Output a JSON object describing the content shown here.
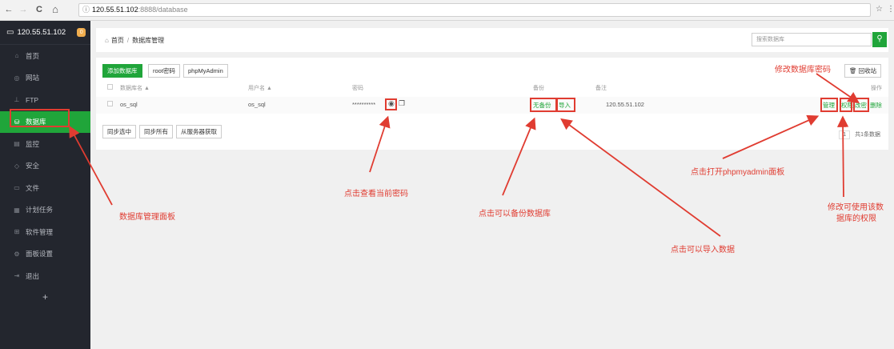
{
  "browser": {
    "back": "←",
    "forward": "→",
    "reload": "C",
    "home": "⌂",
    "info": "ⓘ",
    "host": "120.55.51.102",
    "path": ":8888/database",
    "star": "☆",
    "menu": "⋮"
  },
  "sidebar": {
    "server": "120.55.51.102",
    "badge": "0",
    "items": [
      {
        "label": "首页",
        "icon": "home-icon"
      },
      {
        "label": "网站",
        "icon": "globe-icon"
      },
      {
        "label": "FTP",
        "icon": "ftp-icon"
      },
      {
        "label": "数据库",
        "icon": "database-icon"
      },
      {
        "label": "监控",
        "icon": "monitor-icon"
      },
      {
        "label": "安全",
        "icon": "shield-icon"
      },
      {
        "label": "文件",
        "icon": "folder-icon"
      },
      {
        "label": "计划任务",
        "icon": "calendar-icon"
      },
      {
        "label": "软件管理",
        "icon": "grid-icon"
      },
      {
        "label": "面板设置",
        "icon": "gear-icon"
      },
      {
        "label": "退出",
        "icon": "logout-icon"
      }
    ],
    "add": "+"
  },
  "topbar": {
    "home": "首页",
    "sep": "/",
    "current": "数据库管理",
    "search_placeholder": "搜索数据库"
  },
  "toolbar": {
    "add_db": "添加数据库",
    "root_pwd": "root密码",
    "phpmyadmin": "phpMyAdmin",
    "recycle": "回收站"
  },
  "table": {
    "headers": {
      "name": "数据库名",
      "user": "用户名",
      "password": "密码",
      "backup": "备份",
      "note": "备注",
      "ops": "操作"
    },
    "row": {
      "name": "os_sql",
      "user": "os_sql",
      "password": "**********",
      "backup": "无备份",
      "import": "导入",
      "note": "120.55.51.102",
      "manage": "管理",
      "perm": "权限",
      "change_pwd": "改密",
      "delete": "删除"
    }
  },
  "footer_buttons": {
    "sync_selected": "同步选中",
    "sync_all": "同步所有",
    "from_server": "从服务器获取"
  },
  "pager": {
    "page": "1",
    "total": "共1条数据"
  },
  "annotations": {
    "panel": "数据库管理面板",
    "view_password": "点击查看当前密码",
    "backup": "点击可以备份数据库",
    "import": "点击可以导入数据",
    "phpmyadmin": "点击打开phpmyadmin面板",
    "change_password": "修改数据库密码",
    "permission_line1": "修改可使用该数",
    "permission_line2": "据库的权限"
  },
  "colors": {
    "accent": "#20a53a",
    "annotation": "#e03c31",
    "sidebar_bg": "#23262e"
  }
}
